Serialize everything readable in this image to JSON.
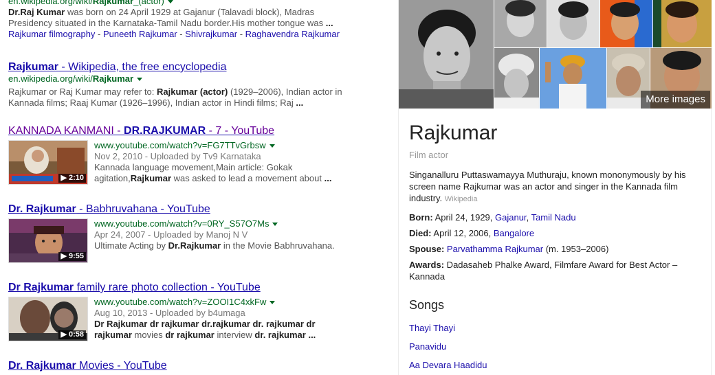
{
  "results": {
    "r0": {
      "url_prefix": "en.wikipedia.org/wiki/",
      "url_bold": "Rajkumar",
      "url_suffix": "_(actor)",
      "snippet_b1": "Dr.Raj Kumar",
      "snippet_1": " was born on 24 April 1929 at Gajanur (Talavadi block), Madras Presidency situated in the Karnataka-Tamil Nadu border.His mother tongue was ",
      "snippet_end": "...",
      "sublinks": [
        "Rajkumar filmography",
        "Puneeth Rajkumar",
        "Shivrajkumar",
        "Raghavendra Rajkumar"
      ],
      "sublink_sep": " - "
    },
    "r1": {
      "title_bold": "Rajkumar",
      "title_rest": " - Wikipedia, the free encyclopedia",
      "url_prefix": "en.wikipedia.org/wiki/",
      "url_bold": "Rajkumar",
      "snippet_1": "Rajkumar or Raj Kumar may refer to: ",
      "snippet_b1": "Rajkumar (actor)",
      "snippet_2": " (1929–2006), Indian actor in Kannada films; Raaj Kumar (1926–1996), Indian actor in Hindi films; Raj ",
      "snippet_end": "..."
    },
    "r2": {
      "title_1": "KANNADA KANMANI - ",
      "title_bold": "DR.RAJKUMAR",
      "title_rest": " - 7 - YouTube",
      "url": "www.youtube.com/watch?v=FG7TTvGrbsw",
      "meta": "Nov 2, 2010 - Uploaded by Tv9 Karnataka",
      "snippet_1": "Kannada language movement,Main article: Gokak agitation,",
      "snippet_b1": "Rajkumar",
      "snippet_2": " was asked to lead a movement about ",
      "snippet_end": "...",
      "duration": "▶ 2:10"
    },
    "r3": {
      "title_bold": "Dr. Rajkumar",
      "title_rest": " - Babhruvahana - YouTube",
      "url": "www.youtube.com/watch?v=0RY_S57O7Ms",
      "meta": "Apr 24, 2007 - Uploaded by Manoj N V",
      "snippet_1": "Ultimate Acting by ",
      "snippet_b1": "Dr.Rajkumar",
      "snippet_2": " in the Movie Babhruvahana.",
      "duration": "▶ 9:55"
    },
    "r4": {
      "title_bold": "Dr Rajkumar",
      "title_rest": " family rare photo collection - YouTube",
      "url": "www.youtube.com/watch?v=ZOOI1C4xkFw",
      "meta": "Aug 10, 2013 - Uploaded by b4umaga",
      "snippet_b1": "Dr Rajkumar dr rajkumar dr.rajkumar dr. rajkumar dr rajkumar",
      "snippet_1": " movies ",
      "snippet_b2": "dr rajkumar",
      "snippet_2": " interview ",
      "snippet_b3": "dr. rajkumar",
      "snippet_end": " ...",
      "duration": "▶ 0:58"
    },
    "r5": {
      "title_bold": "Dr. Rajkumar",
      "title_rest": " Movies - YouTube"
    }
  },
  "panel": {
    "more_images": "More images",
    "title": "Rajkumar",
    "subtitle": "Film actor",
    "description": "Singanalluru Puttaswamayya Muthuraju, known mononymously by his screen name Rajkumar was an actor and singer in the Kannada film industry. ",
    "description_source": "Wikipedia",
    "born_label": "Born:",
    "born_text": " April 24, 1929, ",
    "born_link1": "Gajanur",
    "born_sep": ", ",
    "born_link2": "Tamil Nadu",
    "died_label": "Died:",
    "died_text": " April 12, 2006, ",
    "died_link": "Bangalore",
    "spouse_label": "Spouse:",
    "spouse_link": "Parvathamma Rajkumar",
    "spouse_rest": " (m. 1953–2006)",
    "awards_label": "Awards:",
    "awards_text": " Dadasaheb Phalke Award, Filmfare Award for Best Actor – Kannada",
    "songs_heading": "Songs",
    "songs": [
      "Thayi Thayi",
      "Panavidu",
      "Aa Devara Haadidu"
    ]
  },
  "colors": {
    "link": "#1a0dab",
    "visited": "#660099",
    "url_green": "#006621",
    "snippet": "#545454"
  }
}
